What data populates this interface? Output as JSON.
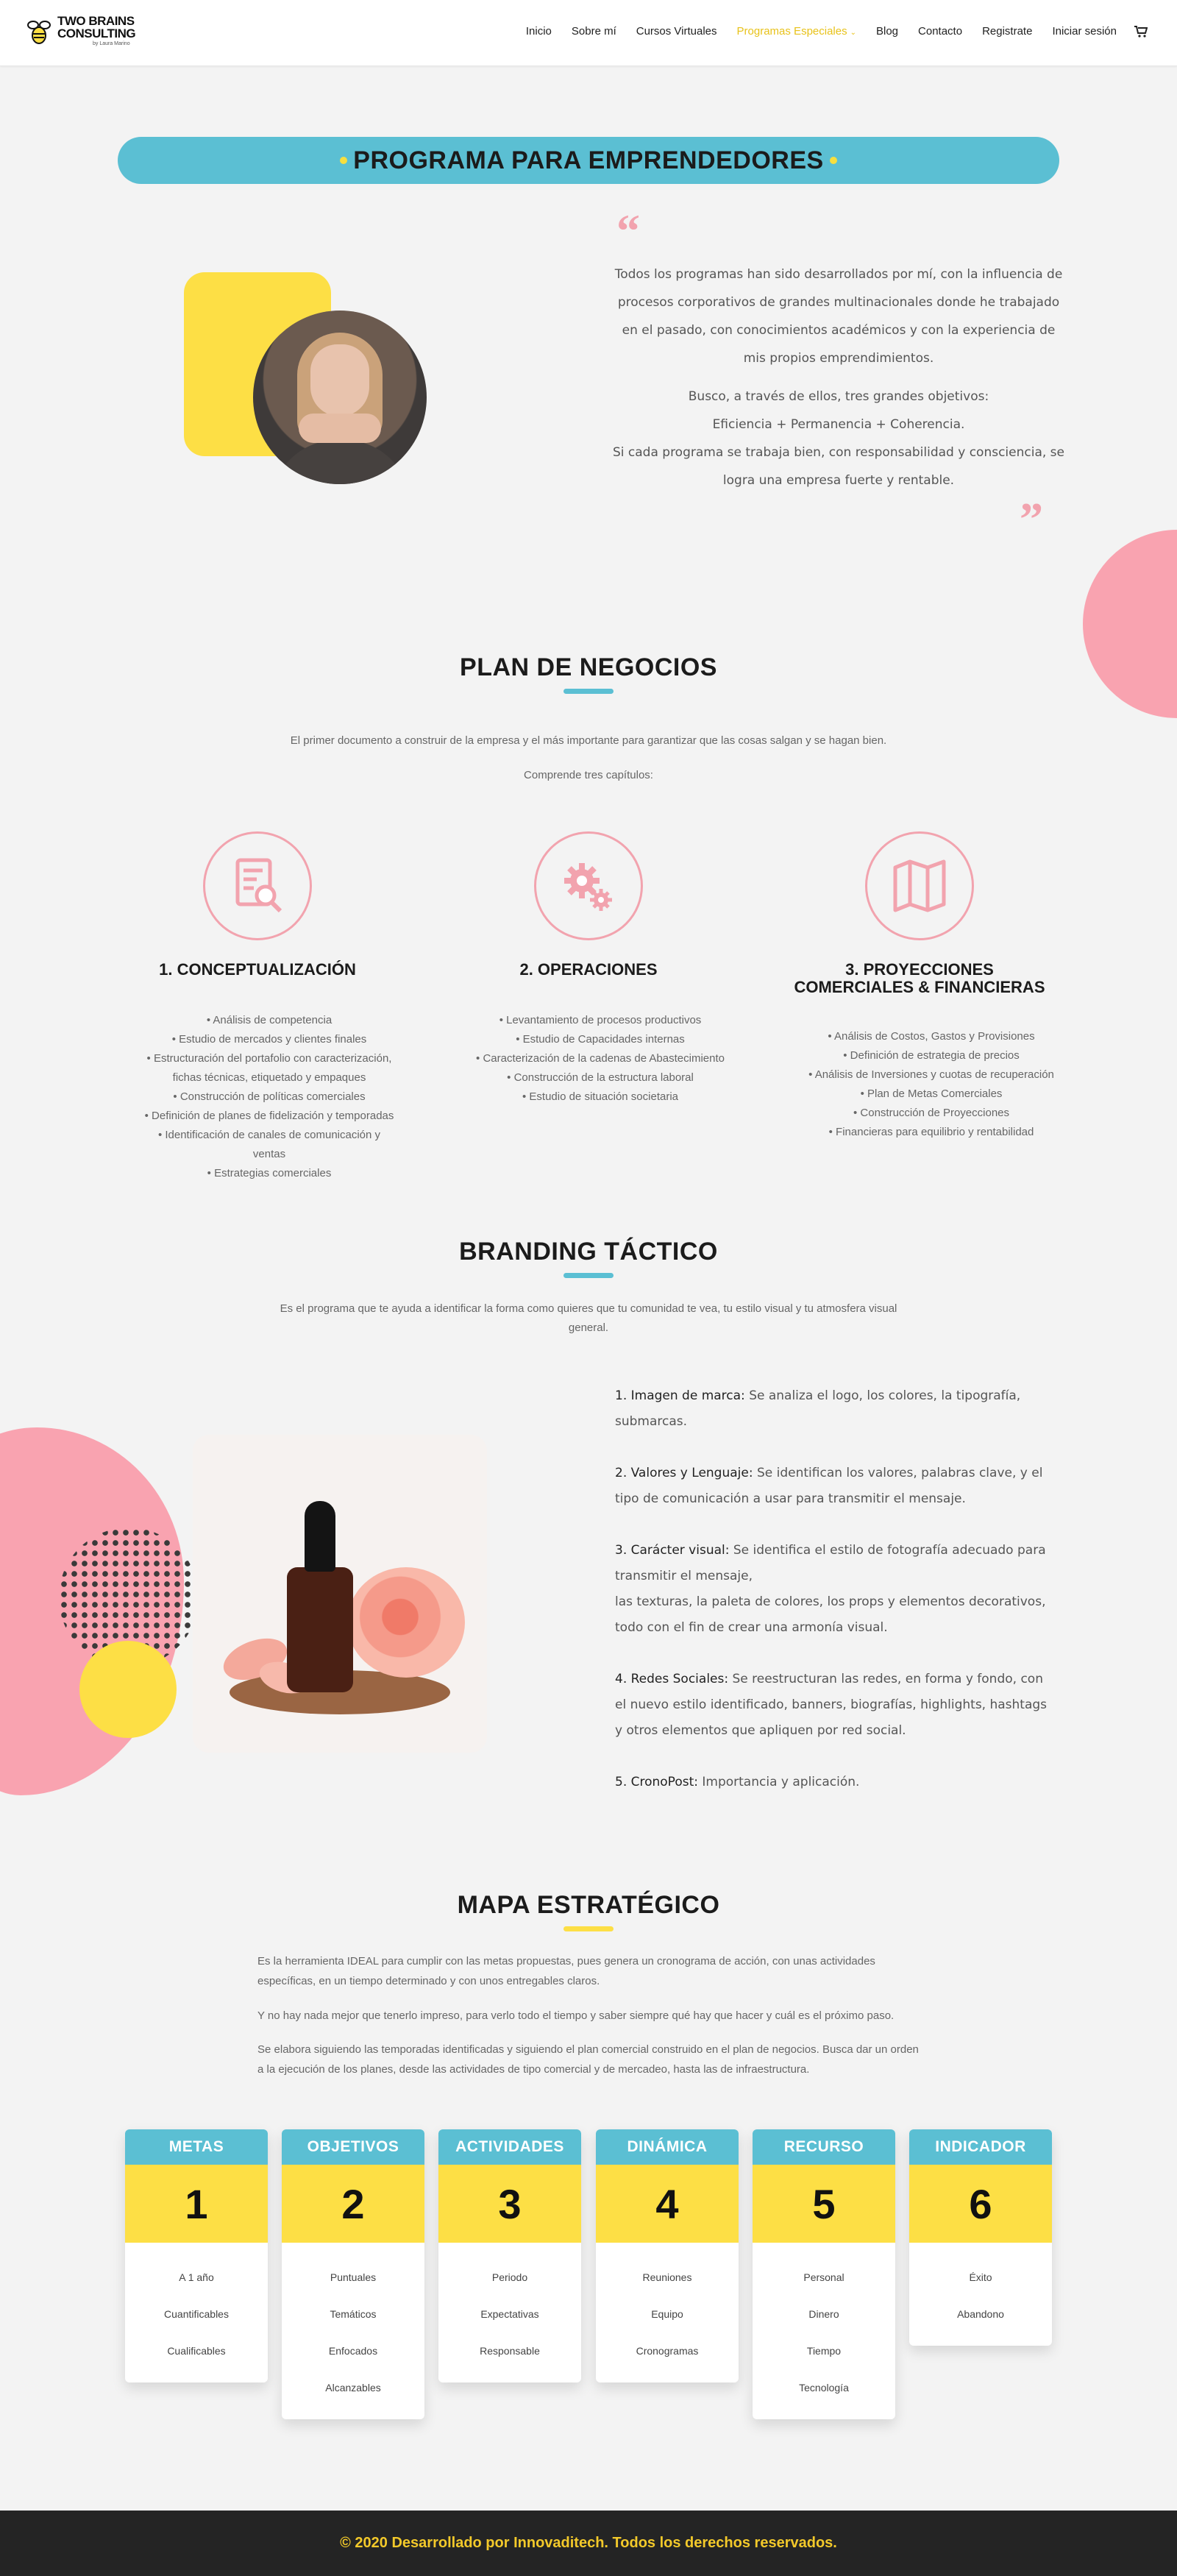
{
  "header": {
    "logo_line1": "TWO BRAINS",
    "logo_line2": "CONSULTING",
    "logo_sub": "by Laura Marino",
    "nav": [
      "Inicio",
      "Sobre mí",
      "Cursos Virtuales",
      "Programas Especiales",
      "Blog",
      "Contacto",
      "Registrate",
      "Iniciar sesión"
    ],
    "active_nav": "Programas Especiales",
    "cart_icon": "cart-icon"
  },
  "program_banner": {
    "title": "PROGRAMA PARA EMPRENDEDORES"
  },
  "intro": {
    "paragraph1": "Todos los programas han sido desarrollados por mí, con la influencia de procesos corporativos de grandes multinacionales donde he trabajado en el pasado, con conocimientos académicos y con la experiencia de mis propios emprendimientos.",
    "paragraph2_line1": "Busco, a través de ellos, tres grandes objetivos:",
    "paragraph2_line2": "Eficiencia + Permanencia + Coherencia.",
    "paragraph2_line3": "Si cada programa se trabaja bien, con responsabilidad y consciencia, se logra una empresa fuerte y rentable.",
    "quote_open": "“",
    "quote_close": "”"
  },
  "plan": {
    "title": "PLAN DE NEGOCIOS",
    "intro1": "El primer documento a construir de la empresa y el más importante para garantizar que las cosas salgan y se hagan bien.",
    "intro2": "Comprende tres capítulos:",
    "columns": [
      {
        "icon": "document-search-icon",
        "title": "1. CONCEPTUALIZACIÓN",
        "items": [
          "Análisis de competencia",
          "Estudio de mercados y clientes finales",
          "Estructuración del portafolio con caracterización,",
          "fichas técnicas, etiquetado y empaques",
          "Construcción de políticas comerciales",
          "Definición de planes de fidelización y temporadas",
          "Identificación de canales de comunicación y",
          "ventas",
          "Estrategias comerciales"
        ]
      },
      {
        "icon": "gears-icon",
        "title": "2. OPERACIONES",
        "items": [
          "Levantamiento de procesos productivos",
          "Estudio de Capacidades internas",
          "Caracterización de la cadenas de Abastecimiento",
          "Construcción de la estructura laboral",
          "Estudio de situación societaria"
        ]
      },
      {
        "icon": "map-icon",
        "title_line1": "3. PROYECCIONES",
        "title_line2": "COMERCIALES & FINANCIERAS",
        "items": [
          "Análisis de Costos, Gastos y Provisiones",
          "Definición de estrategia de precios",
          "Análisis de Inversiones y cuotas de recuperación",
          "Plan de Metas Comerciales",
          "Construcción de Proyecciones",
          "Financieras para equilibrio y rentabilidad"
        ]
      }
    ]
  },
  "branding": {
    "title": "BRANDING TÁCTICO",
    "intro_line1": "Es el programa que te ayuda a identificar la forma como quieres que tu comunidad te vea, tu estilo visual y tu atmosfera visual",
    "intro_line2": "general.",
    "items": [
      {
        "lead": "1. Imagen de marca:",
        "text": " Se analiza el logo, los colores, la tipografía, submarcas."
      },
      {
        "lead": "2. Valores y Lenguaje:",
        "text": " Se identifican los valores,  palabras clave, y el tipo de comunicación a usar para transmitir el mensaje."
      },
      {
        "lead": "3. Carácter visual:",
        "text": " Se identifica el estilo de fotografía adecuado para transmitir el mensaje,",
        "text2": "las texturas, la paleta de colores, los props y elementos decorativos, todo con el fin de crear una armonía visual."
      },
      {
        "lead": "4. Redes Sociales:",
        "text": " Se reestructuran las redes, en forma y fondo, con el nuevo estilo identificado, banners, biografías, highlights, hashtags y otros elementos que apliquen por red social."
      },
      {
        "lead": "5. CronoPost:",
        "text": " Importancia y aplicación."
      }
    ]
  },
  "mapa": {
    "title": "MAPA ESTRATÉGICO",
    "p1": "Es la herramienta IDEAL para cumplir con las metas propuestas, pues genera un cronograma de acción, con unas actividades específicas, en un tiempo determinado y con unos entregables claros.",
    "p2": "Y no hay nada mejor que tenerlo impreso, para verlo todo el tiempo y saber siempre qué hay que hacer y cuál es el próximo paso.",
    "p3": "Se elabora siguiendo las temporadas identificadas y siguiendo el plan comercial construido en el plan de negocios. Busca dar un orden a la ejecución de los planes, desde las actividades de tipo comercial y de mercadeo, hasta las de infraestructura.",
    "cards": [
      {
        "title": "METAS",
        "number": "1",
        "items": [
          "A 1 año",
          "Cuantificables",
          "Cualificables"
        ]
      },
      {
        "title": "OBJETIVOS",
        "number": "2",
        "items": [
          "Puntuales",
          "Temáticos",
          "Enfocados",
          "Alcanzables"
        ]
      },
      {
        "title": "ACTIVIDADES",
        "number": "3",
        "items": [
          "Periodo",
          "Expectativas",
          "Responsable"
        ]
      },
      {
        "title": "DINÁMICA",
        "number": "4",
        "items": [
          "Reuniones",
          "Equipo",
          "Cronogramas"
        ]
      },
      {
        "title": "RECURSO",
        "number": "5",
        "items": [
          "Personal",
          "Dinero",
          "Tiempo",
          "Tecnología"
        ]
      },
      {
        "title": "INDICADOR",
        "number": "6",
        "items": [
          "Éxito",
          "Abandono"
        ]
      }
    ]
  },
  "footer": {
    "text": "© 2020 Desarrollado por Innovaditech. Todos los derechos reservados."
  },
  "colors": {
    "accent_blue": "#5bbfd3",
    "accent_yellow": "#fddf45",
    "accent_pink": "#f2a3ae",
    "footer_bg": "#242424",
    "footer_text": "#f3c92a"
  }
}
